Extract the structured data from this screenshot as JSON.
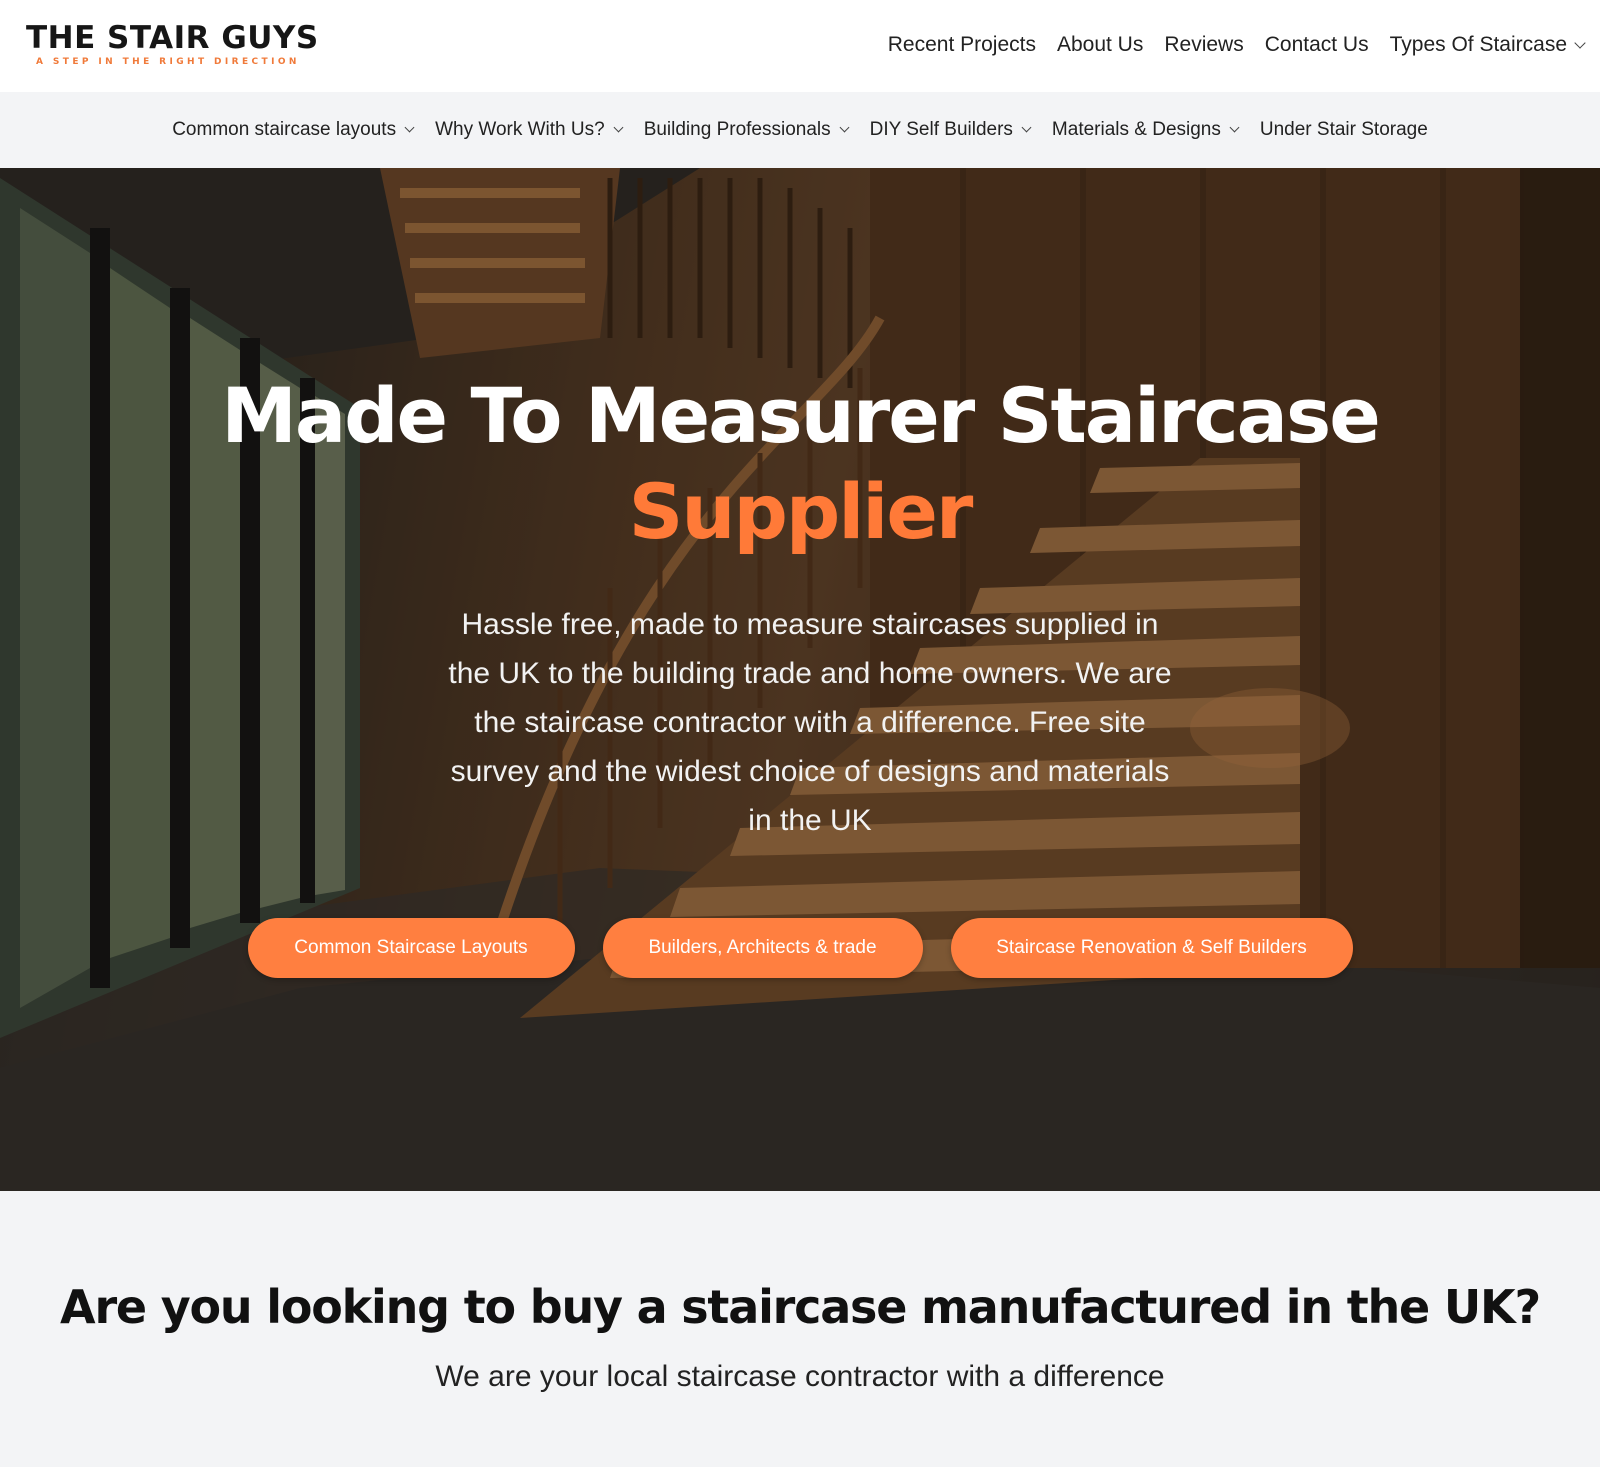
{
  "brand": {
    "name": "THE STAIR GUYS",
    "tagline": "A STEP IN THE RIGHT DIRECTION",
    "accent_color": "#ff7a38"
  },
  "top_nav": {
    "items": [
      {
        "label": "Recent Projects",
        "has_dropdown": false
      },
      {
        "label": "About Us",
        "has_dropdown": false
      },
      {
        "label": "Reviews",
        "has_dropdown": false
      },
      {
        "label": "Contact Us",
        "has_dropdown": false
      },
      {
        "label": "Types Of Staircase",
        "has_dropdown": true
      }
    ]
  },
  "sub_nav": {
    "items": [
      {
        "label": "Common staircase layouts",
        "has_dropdown": true
      },
      {
        "label": "Why Work With Us?",
        "has_dropdown": true
      },
      {
        "label": "Building Professionals",
        "has_dropdown": true
      },
      {
        "label": "DIY Self Builders",
        "has_dropdown": true
      },
      {
        "label": "Materials & Designs",
        "has_dropdown": true
      },
      {
        "label": "Under Stair Storage",
        "has_dropdown": false
      }
    ]
  },
  "hero": {
    "title_line1": "Made To Measurer Staircase",
    "title_line2": "Supplier",
    "description": "Hassle free, made to measure staircases supplied in the UK to the building trade and home owners. We are the staircase contractor with a difference.  Free site survey and the widest choice of designs and materials in the UK",
    "buttons": [
      {
        "label": "Common Staircase Layouts"
      },
      {
        "label": "Builders, Architects & trade"
      },
      {
        "label": "Staircase Renovation & Self Builders"
      }
    ]
  },
  "intro": {
    "title": "Are you looking to buy a staircase manufactured in the UK?",
    "subtitle": "We are your local staircase contractor with a difference"
  }
}
